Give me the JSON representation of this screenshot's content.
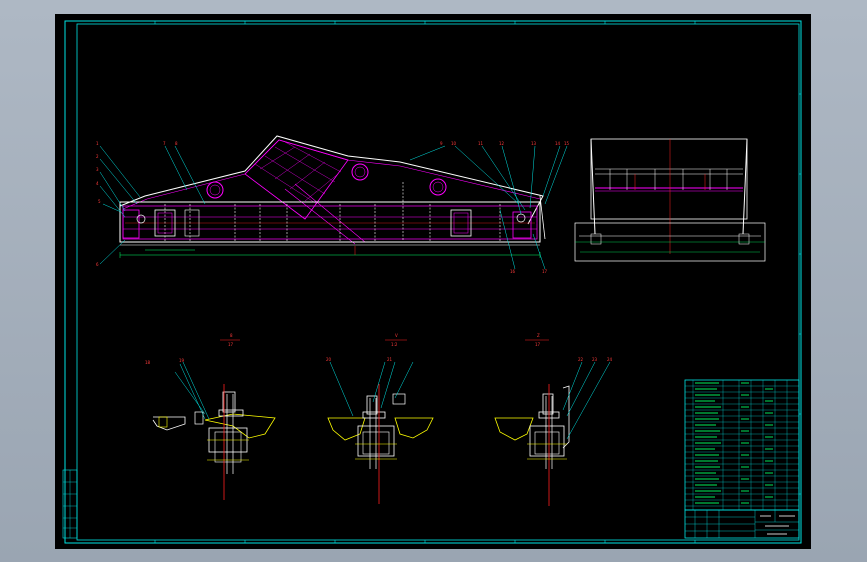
{
  "view_labels": {
    "section_a": {
      "top": "8",
      "bottom": "17"
    },
    "section_b": {
      "top": "V",
      "bottom": "1:2"
    },
    "section_c": {
      "top": "Z",
      "bottom": "17"
    }
  },
  "callouts": {
    "main": [
      "1",
      "2",
      "3",
      "4",
      "5",
      "6",
      "7",
      "8",
      "9",
      "10",
      "11",
      "12",
      "13",
      "14",
      "15",
      "16",
      "17"
    ],
    "detail": [
      "18",
      "19",
      "20",
      "21",
      "22",
      "23",
      "24",
      "25"
    ]
  },
  "colors": {
    "frame": "#00e5e5",
    "steel": "#ffffff",
    "screen": "#ff00ff",
    "center_line": "#ff2020",
    "bolt": "#ffff00",
    "dimension": "#00ff66"
  }
}
